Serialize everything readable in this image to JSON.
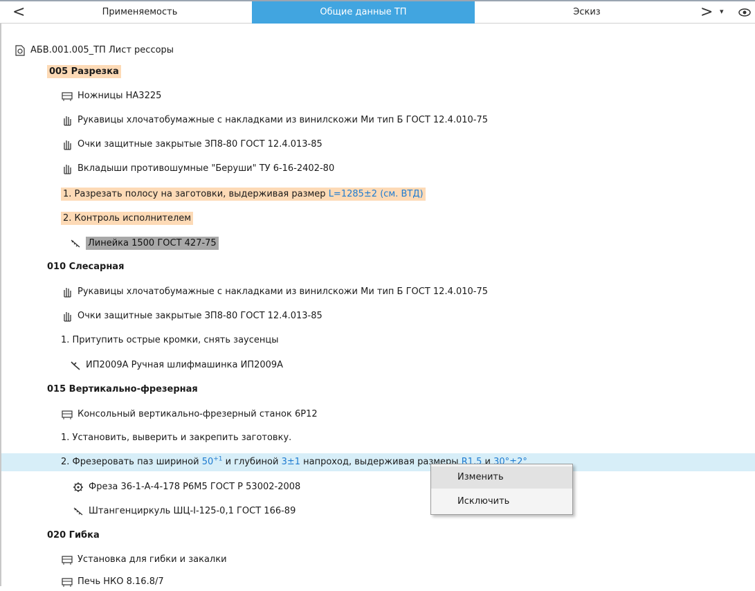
{
  "tabs": {
    "prev": "<",
    "next": ">",
    "menu": "▾",
    "items": [
      "Применяемость",
      "Общие данные ТП",
      "Эскиз"
    ]
  },
  "tree": {
    "root": "АБВ.001.005_ТП Лист рессоры",
    "op005": {
      "title": "005 Разрезка",
      "equip": "Ножницы НА3225",
      "ppe1": "Рукавицы хлочатобумажные с накладками из винилскожи  Ми тип Б ГОСТ 12.4.010-75",
      "ppe2": "Очки защитные закрытые ЗП8-80 ГОСТ 12.4.013-85",
      "ppe3": "Вкладыши противошумные \"Беруши\" ТУ 6-16-2402-80",
      "step1_text": "1. Разрезать полосу на заготовки, выдерживая размер ",
      "step1_dim": "L=1285±2 (см. ВТД)",
      "step2": "2. Контроль исполнителем",
      "tool": "Линейка 1500 ГОСТ 427-75"
    },
    "op010": {
      "title": "010 Слесарная",
      "ppe1": "Рукавицы хлочатобумажные с накладками из винилскожи  Ми тип Б ГОСТ 12.4.010-75",
      "ppe2": "Очки защитные закрытые ЗП8-80 ГОСТ 12.4.013-85",
      "step1": "1. Притупить острые кромки, снять заусенцы",
      "tool": "ИП2009А Ручная шлифмашинка ИП2009А"
    },
    "op015": {
      "title": "015 Вертикально-фрезерная",
      "equip": "Консольный вертикально-фрезерный станок 6Р12",
      "step1": "1. Установить, выверить и закрепить заготовку.",
      "step2_a": "2. Фрезеровать паз шириной ",
      "step2_w": "50",
      "step2_wsup": "+1",
      "step2_b": " и глубиной ",
      "step2_d": "3±1",
      "step2_c": " напроход, выдерживая размеры ",
      "step2_r": "R1,5",
      "step2_and": " и ",
      "step2_ang": "30°±2°",
      "tool1": "Фреза 36-1-А-4-178 Р6М5 ГОСТ Р 53002-2008",
      "tool2": "Штангенциркуль ШЦ-I-125-0,1 ГОСТ 166-89"
    },
    "op020": {
      "title": "020 Гибка",
      "equip1": "Установка для гибки и закалки",
      "equip2": "Печь НКО 8.16.8/7"
    }
  },
  "context_menu": {
    "edit": "Изменить",
    "exclude": "Исключить"
  },
  "colors": {
    "accent": "#41a5e0",
    "highlight": "#fddab6",
    "selected_row": "#d7eef8",
    "dimension_text": "#1e7bd0"
  },
  "icons": [
    "document-icon",
    "machine-icon",
    "glove-icon",
    "ruler-icon",
    "grinder-icon",
    "cutter-icon",
    "caliper-icon",
    "eye-icon"
  ]
}
